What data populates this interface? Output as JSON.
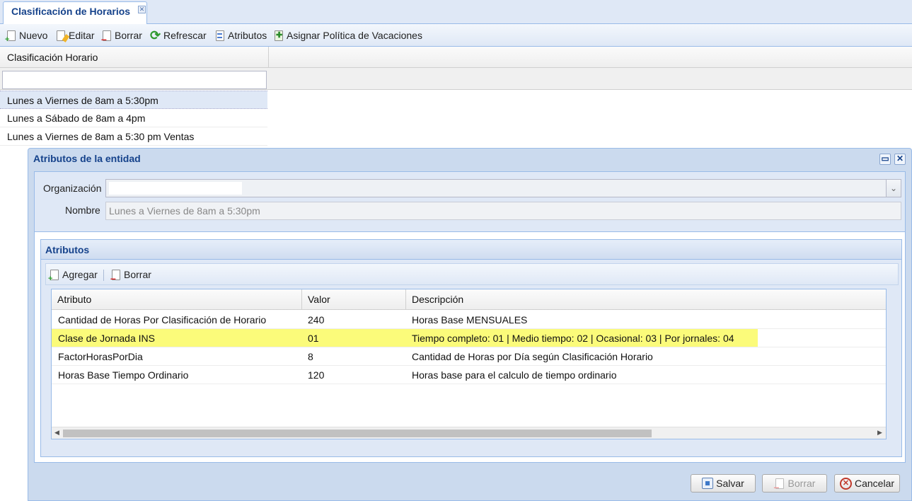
{
  "tab": {
    "title": "Clasificación de Horarios",
    "close_glyph": "✕"
  },
  "toolbar": {
    "nuevo": "Nuevo",
    "editar": "Editar",
    "borrar": "Borrar",
    "refrescar": "Refrescar",
    "atributos": "Atributos",
    "asignar": "Asignar Política de Vacaciones"
  },
  "grid": {
    "column": "Clasificación Horario",
    "filter_value": "",
    "rows": [
      "Lunes a Viernes de 8am a 5:30pm",
      "Lunes a Sábado de 8am a 4pm",
      "Lunes a Viernes de 8am a 5:30 pm Ventas"
    ]
  },
  "window": {
    "title": "Atributos de la entidad",
    "maximize_glyph": "▭",
    "close_glyph": "✕",
    "organizacion_label": "Organización",
    "organizacion_value": "",
    "nombre_label": "Nombre",
    "nombre_value": "Lunes a Viernes de 8am a 5:30pm",
    "panel": {
      "title": "Atributos",
      "agregar": "Agregar",
      "borrar": "Borrar",
      "columns": [
        "Atributo",
        "Valor",
        "Descripción"
      ],
      "rows": [
        {
          "atributo": "Cantidad de Horas Por Clasificación de Horario",
          "valor": "240",
          "descripcion": "Horas Base MENSUALES"
        },
        {
          "atributo": "Clase de Jornada INS",
          "valor": "01",
          "descripcion": "Tiempo completo: 01 | Medio tiempo: 02 | Ocasional: 03 | Por jornales: 04"
        },
        {
          "atributo": "FactorHorasPorDia",
          "valor": "8",
          "descripcion": "Cantidad de Horas por Día según Clasificación Horario"
        },
        {
          "atributo": "Horas Base Tiempo Ordinario",
          "valor": "120",
          "descripcion": "Horas base para el calculo de tiempo ordinario"
        }
      ]
    },
    "buttons": {
      "salvar": "Salvar",
      "borrar": "Borrar",
      "cancelar": "Cancelar"
    }
  },
  "colors": {
    "highlight": "#fbfb7a",
    "title_blue": "#15428b",
    "panel_bg": "#dfe8f6"
  },
  "icons": [
    "new-doc-icon",
    "edit-doc-icon",
    "delete-doc-icon",
    "refresh-icon",
    "attributes-icon",
    "vacation-policy-icon",
    "save-icon",
    "cancel-icon"
  ]
}
